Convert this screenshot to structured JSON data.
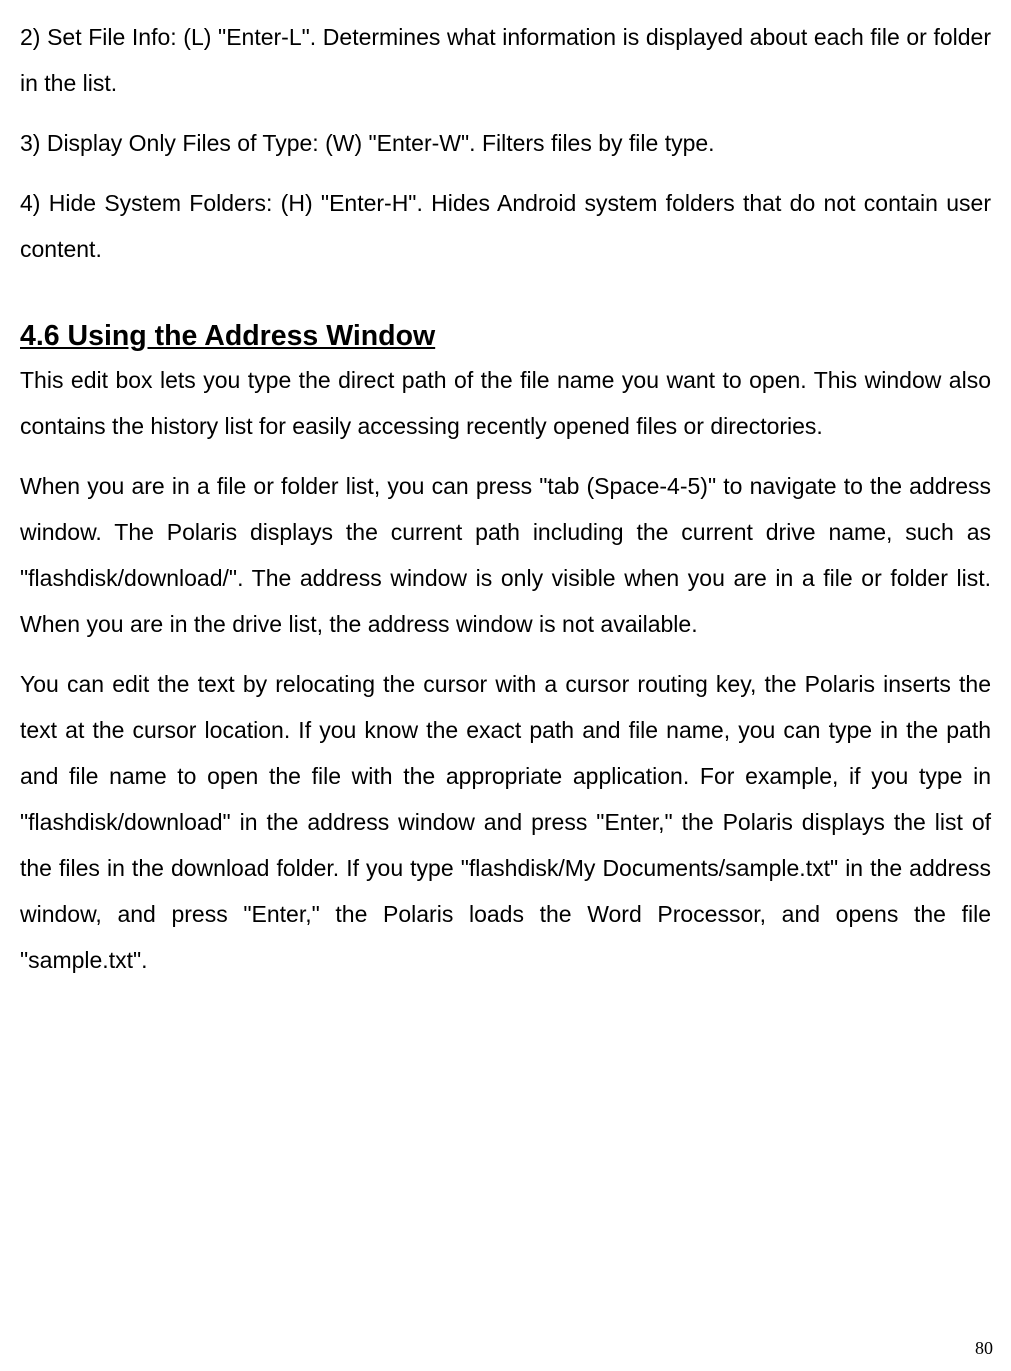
{
  "paragraphs": {
    "p1": "2) Set File Info: (L) \"Enter-L\". Determines what information is displayed about each file or folder in the list.",
    "p2": "3) Display Only Files of Type: (W) \"Enter-W\". Filters files by file type.",
    "p3": "4) Hide System Folders: (H) \"Enter-H\". Hides Android system folders that do not contain user content."
  },
  "heading": "4.6 Using the Address Window",
  "body": {
    "b1": "This edit box lets you type the direct path of the file name you want to open. This window also contains the history list for easily accessing recently opened files or directories.",
    "b2": "When you are in a file or folder list, you can press \"tab (Space-4-5)\" to navigate to the address window. The Polaris displays the current path including the current drive name, such as \"flashdisk/download/\". The address window is only visible when you are in a file or folder list. When you are in the drive list, the address window is not available.",
    "b3": "You can edit the text by relocating the cursor with a cursor routing key, the Polaris inserts the text at the cursor location. If you know the exact path and file name, you can type in the path and file name to open the file with the appropriate application. For example, if you type in \"flashdisk/download\" in the address window and press \"Enter,\" the Polaris displays the list of the files in the download folder. If you type \"flashdisk/My Documents/sample.txt\" in the address window, and press \"Enter,\" the Polaris loads the Word Processor, and opens the file \"sample.txt\"."
  },
  "page_number": "80"
}
